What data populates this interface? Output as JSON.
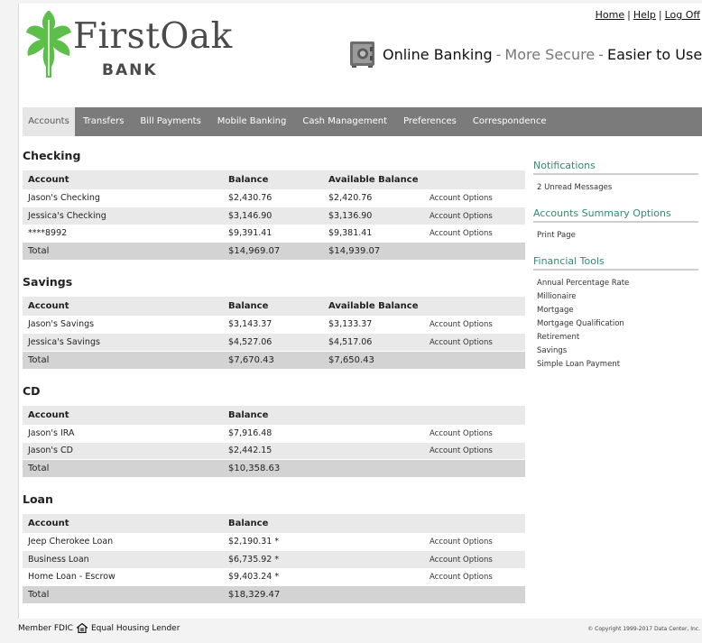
{
  "brand": {
    "name": "FirstOak",
    "sub": "BANK"
  },
  "top_links": [
    "Home",
    "Help",
    "Log Off"
  ],
  "tagline": {
    "part1": "Online Banking",
    "sep": "-",
    "part2": "More Secure",
    "part3": "Easier to Use"
  },
  "nav": [
    "Accounts",
    "Transfers",
    "Bill Payments",
    "Mobile Banking",
    "Cash Management",
    "Preferences",
    "Correspondence"
  ],
  "headers": {
    "account": "Account",
    "balance": "Balance",
    "available": "Available Balance"
  },
  "checking": {
    "title": "Checking",
    "rows": [
      {
        "name": "Jason's Checking",
        "balance": "$2,430.76",
        "available": "$2,420.76",
        "option": "Account Options"
      },
      {
        "name": "Jessica's Checking",
        "balance": "$3,146.90",
        "available": "$3,136.90",
        "option": "Account Options"
      },
      {
        "name": "****8992",
        "balance": "$9,391.41",
        "available": "$9,381.41",
        "option": "Account Options"
      }
    ],
    "total": {
      "label": "Total",
      "balance": "$14,969.07",
      "available": "$14,939.07"
    }
  },
  "savings": {
    "title": "Savings",
    "rows": [
      {
        "name": "Jason's Savings",
        "balance": "$3,143.37",
        "available": "$3,133.37",
        "option": "Account Options"
      },
      {
        "name": "Jessica's Savings",
        "balance": "$4,527.06",
        "available": "$4,517.06",
        "option": "Account Options"
      }
    ],
    "total": {
      "label": "Total",
      "balance": "$7,670.43",
      "available": "$7,650.43"
    }
  },
  "cd": {
    "title": "CD",
    "rows": [
      {
        "name": "Jason's IRA",
        "balance": "$7,916.48",
        "option": "Account Options"
      },
      {
        "name": "Jason's CD",
        "balance": "$2,442.15",
        "option": "Account Options"
      }
    ],
    "total": {
      "label": "Total",
      "balance": "$10,358.63"
    }
  },
  "loan": {
    "title": "Loan",
    "rows": [
      {
        "name": "Jeep Cherokee Loan",
        "balance": "$2,190.31 *",
        "option": "Account Options"
      },
      {
        "name": "Business Loan",
        "balance": "$6,735.92 *",
        "option": "Account Options"
      },
      {
        "name": "Home Loan - Escrow",
        "balance": "$9,403.24 *",
        "option": "Account Options"
      }
    ],
    "total": {
      "label": "Total",
      "balance": "$18,329.47"
    }
  },
  "sidebar": {
    "notifications": {
      "title": "Notifications",
      "items": [
        "2 Unread Messages"
      ]
    },
    "summary_options": {
      "title": "Accounts Summary Options",
      "items": [
        "Print Page"
      ]
    },
    "financial_tools": {
      "title": "Financial Tools",
      "items": [
        "Annual Percentage Rate",
        "Millionaire",
        "Mortgage",
        "Mortgage Qualification",
        "Retirement",
        "Savings",
        "Simple Loan Payment"
      ]
    }
  },
  "footer": {
    "fdic": "Member FDIC",
    "housing": "Equal Housing Lender",
    "copyright": "© Copyright 1999-2017 Data Center, Inc."
  },
  "colors": {
    "accent_green": "#2e8e6b",
    "leaf_green": "#5cbf4a",
    "nav_gray": "#7b7b7b"
  },
  "icons": {
    "logo": "oak-leaf-icon",
    "safe": "safe-icon",
    "housing": "house-icon"
  }
}
